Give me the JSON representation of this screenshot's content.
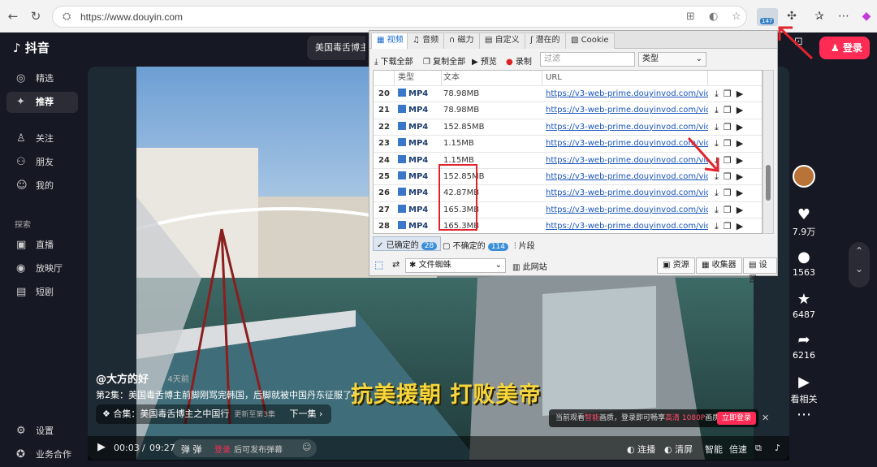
{
  "browser": {
    "url": "https://www.douyin.com",
    "ext_badge": "147"
  },
  "app": {
    "logo": "抖音",
    "search_text": "美国毒舌博主",
    "login": "登录"
  },
  "sidebar": {
    "items": [
      {
        "label": "精选",
        "icon": "compass-icon"
      },
      {
        "label": "推荐",
        "icon": "sparkle-icon",
        "active": true
      },
      {
        "label": "关注",
        "icon": "user-follow-icon"
      },
      {
        "label": "朋友",
        "icon": "friends-icon"
      },
      {
        "label": "我的",
        "icon": "profile-icon"
      }
    ],
    "explore": "探索",
    "items2": [
      {
        "label": "直播",
        "icon": "live-icon"
      },
      {
        "label": "放映厅",
        "icon": "cinema-icon"
      },
      {
        "label": "短剧",
        "icon": "drama-icon"
      }
    ],
    "bottom": [
      {
        "label": "设置"
      },
      {
        "label": "业务合作"
      }
    ]
  },
  "video": {
    "author": "@大方的好",
    "time_ago": "· 4天前",
    "desc": "第2集：美国毒舌博主前脚刚骂完韩国，后脚就被中国丹东征服了！",
    "collection": "合集：美国毒舌博主之中国行",
    "collection_count": "更新至第3集",
    "next": "下一集 ›",
    "subtitle": "抗美援朝 打败美帝",
    "time_current": "00:03",
    "time_total": "09:27",
    "comment_login": "登录",
    "comment_hint": "后可发布弹幕",
    "controls": [
      "连播",
      "清屏",
      "智能",
      "倍速"
    ]
  },
  "actions": {
    "likes": "7.9万",
    "comments": "1563",
    "favorites": "6487",
    "shares": "6216",
    "related": "看相关"
  },
  "promo": {
    "text1": "当前观看",
    "hl1": "智能",
    "text2": "画质，登录即可畅享",
    "hl2": "高清 1080P",
    "text3": "画质",
    "btn": "立即登录"
  },
  "extension": {
    "tabs": [
      "视频",
      "音频",
      "磁力",
      "自定义",
      "潜在的",
      "Cookie"
    ],
    "toolbar": {
      "download_all": "下载全部",
      "copy_all": "复制全部",
      "preview": "预览",
      "record": "录制",
      "filter_placeholder": "过滤",
      "type": "类型"
    },
    "columns": [
      "类型",
      "文本",
      "URL"
    ],
    "rows": [
      {
        "n": "20",
        "type": "MP4",
        "size": "78.98MB",
        "url": "https://v3-web-prime.douyinvod.com/video/tos/..."
      },
      {
        "n": "21",
        "type": "MP4",
        "size": "78.98MB",
        "url": "https://v3-web-prime.douyinvod.com/video/tos/..."
      },
      {
        "n": "22",
        "type": "MP4",
        "size": "152.85MB",
        "url": "https://v3-web-prime.douyinvod.com/video/tos/..."
      },
      {
        "n": "23",
        "type": "MP4",
        "size": "1.15MB",
        "url": "https://v3-web-prime.douyinvod.com/video/tos/..."
      },
      {
        "n": "24",
        "type": "MP4",
        "size": "1.15MB",
        "url": "https://v3-web-prime.douyinvod.com/video/tos/..."
      },
      {
        "n": "25",
        "type": "MP4",
        "size": "152.85MB",
        "url": "https://v3-web-prime.douyinvod.com/video/tos/..."
      },
      {
        "n": "26",
        "type": "MP4",
        "size": "42.87MB",
        "url": "https://v3-web-prime.douyinvod.com/video/tos/..."
      },
      {
        "n": "27",
        "type": "MP4",
        "size": "165.3MB",
        "url": "https://v3-web-prime.douyinvod.com/video/tos/..."
      },
      {
        "n": "28",
        "type": "MP4",
        "size": "165.3MB",
        "url": "https://v3-web-prime.douyinvod.com/video/tos/..."
      }
    ],
    "status": {
      "confirmed": "已确定的",
      "confirmed_count": "28",
      "unconfirmed": "不确定的",
      "unconfirmed_count": "114",
      "fragments": "片段"
    },
    "bottom": {
      "mode": "文件蜘蛛",
      "this_site": "此网站",
      "resources": "资源",
      "collector": "收集器",
      "settings": "设置"
    }
  }
}
